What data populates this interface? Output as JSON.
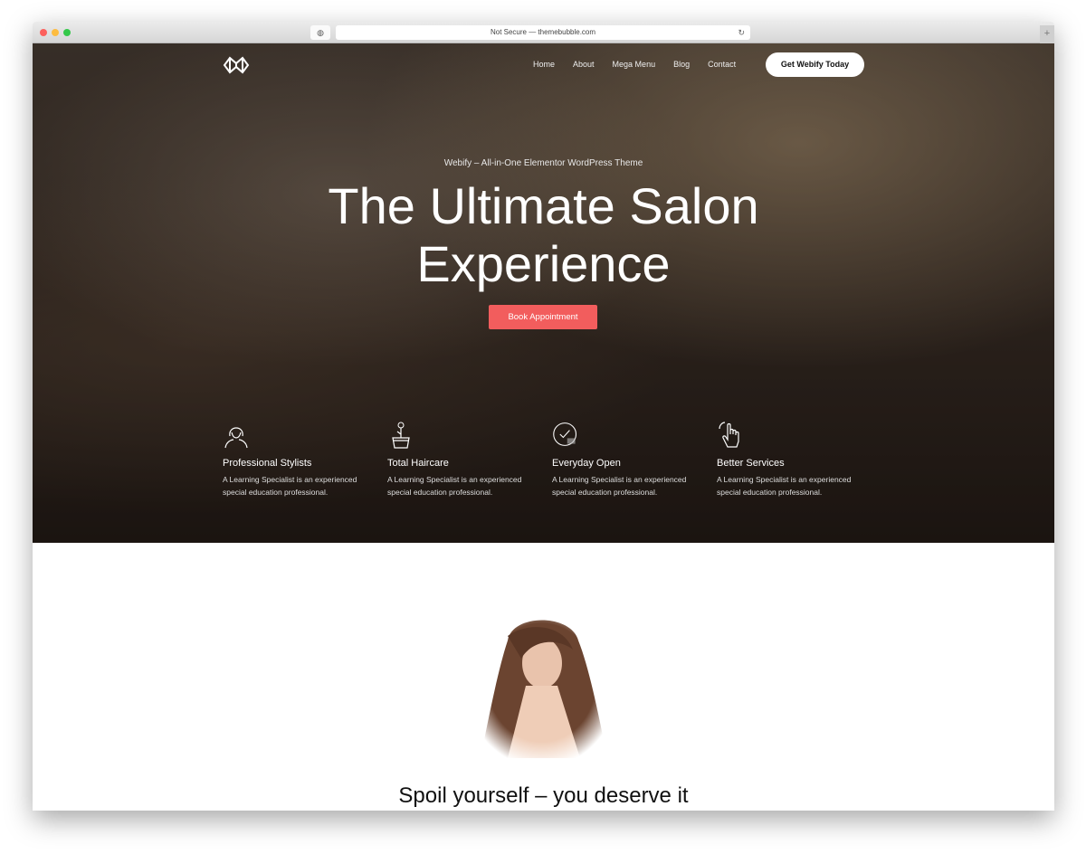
{
  "browser": {
    "address": "Not Secure — themebubble.com",
    "colors": {
      "close": "#fc605c",
      "min": "#fdbc40",
      "max": "#34c84a"
    }
  },
  "nav": {
    "items": [
      "Home",
      "About",
      "Mega Menu",
      "Blog",
      "Contact"
    ],
    "cta": "Get Webify Today"
  },
  "hero": {
    "subtitle": "Webify – All-in-One Elementor WordPress Theme",
    "title": "The Ultimate Salon Experience",
    "button": "Book Appointment",
    "accent": "#f25d5d"
  },
  "features": [
    {
      "icon": "woman-icon",
      "title": "Professional Stylists",
      "text": "A Learning Specialist is an experienced special education professional."
    },
    {
      "icon": "flower-pot-icon",
      "title": "Total Haircare",
      "text": "A Learning Specialist is an experienced special education professional."
    },
    {
      "icon": "clock-check-icon",
      "title": "Everyday Open",
      "text": "A Learning Specialist is an experienced special education professional."
    },
    {
      "icon": "hand-pointer-icon",
      "title": "Better Services",
      "text": "A Learning Specialist is an experienced special education professional."
    }
  ],
  "section": {
    "heading": "Spoil yourself – you deserve it"
  }
}
